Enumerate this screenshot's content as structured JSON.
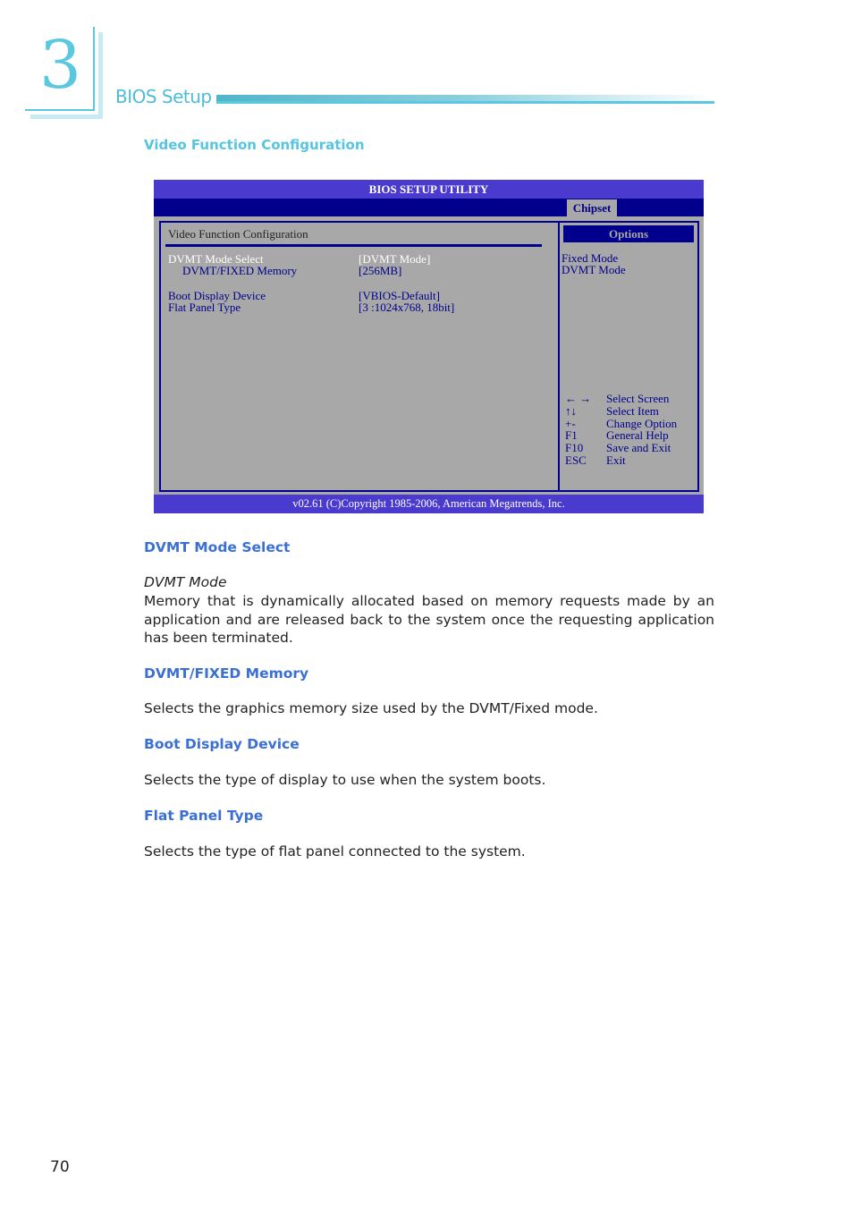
{
  "chapter": {
    "number": "3",
    "title": "BIOS Setup"
  },
  "section_title": "Video Function Configuration",
  "bios": {
    "title": "BIOS SETUP UTILITY",
    "active_tab": "Chipset",
    "section_label": "Video Function Configuration",
    "items": [
      {
        "label": "DVMT Mode Select",
        "value": "[DVMT Mode]",
        "selected": true,
        "indent": false
      },
      {
        "label": "DVMT/FIXED Memory",
        "value": "[256MB]",
        "selected": false,
        "indent": true
      },
      {
        "label": "Boot Display Device",
        "value": "[VBIOS-Default]",
        "selected": false,
        "indent": false
      },
      {
        "label": "Flat Panel Type",
        "value": "[3 :1024x768, 18bit]",
        "selected": false,
        "indent": false
      }
    ],
    "options_header": "Options",
    "options": [
      "Fixed Mode",
      "DVMT Mode"
    ],
    "keys": [
      {
        "key": "← →",
        "desc": "Select Screen"
      },
      {
        "key": "↑↓",
        "desc": "Select Item"
      },
      {
        "key": "+-",
        "desc": "Change Option"
      },
      {
        "key": "F1",
        "desc": "General Help"
      },
      {
        "key": "F10",
        "desc": "Save and Exit"
      },
      {
        "key": "ESC",
        "desc": "Exit"
      }
    ],
    "footer": "v02.61 (C)Copyright 1985-2006, American Megatrends, Inc."
  },
  "sections": [
    {
      "heading": "DVMT Mode Select",
      "subheading": "DVMT Mode",
      "body": "Memory that is dynamically allocated based on memory requests made by an application and are released back to the system once the requesting application has been terminated."
    },
    {
      "heading": "DVMT/FIXED Memory",
      "body": "Selects the graphics memory size used by the DVMT/Fixed mode."
    },
    {
      "heading": "Boot Display Device",
      "body": "Selects the type of display to use when the system boots."
    },
    {
      "heading": "Flat Panel Type",
      "body": "Selects the type of flat panel connected to the system."
    }
  ],
  "page_number": "70",
  "colors": {
    "accent_cyan": "#5bc8df",
    "heading_blue": "#3a6fd4",
    "bios_navy": "#00008c",
    "bios_purple": "#4a3acd",
    "bios_gray": "#a8a8a8"
  }
}
